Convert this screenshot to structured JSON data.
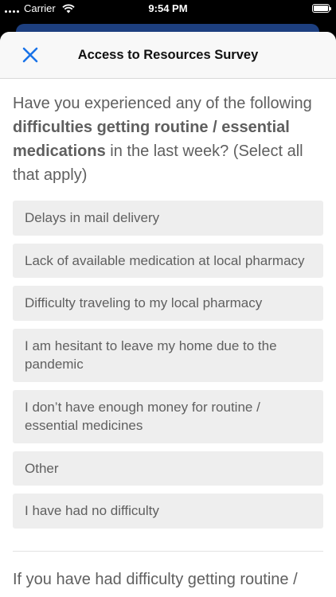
{
  "status_bar": {
    "carrier": "Carrier",
    "time": "9:54 PM",
    "icons": [
      "signal-icon",
      "wifi-icon",
      "battery-icon"
    ]
  },
  "nav": {
    "title": "Access to Resources Survey",
    "close_icon": "close-icon",
    "accent_color": "#1a73e8"
  },
  "question": {
    "prefix": "Have you experienced any of the following ",
    "bold": "difficulties getting routine / essential medications",
    "suffix": " in the last week? (Select all that apply)"
  },
  "options": [
    "Delays in mail delivery",
    "Lack of available medication at local pharmacy",
    "Difficulty traveling to my local pharmacy",
    "I am hesitant to leave my home due to the pandemic",
    "I don’t have enough money for routine / essential medicines",
    "Other",
    "I have had no difficulty"
  ],
  "next_question": {
    "text": "If you have had difficulty getting routine /"
  }
}
